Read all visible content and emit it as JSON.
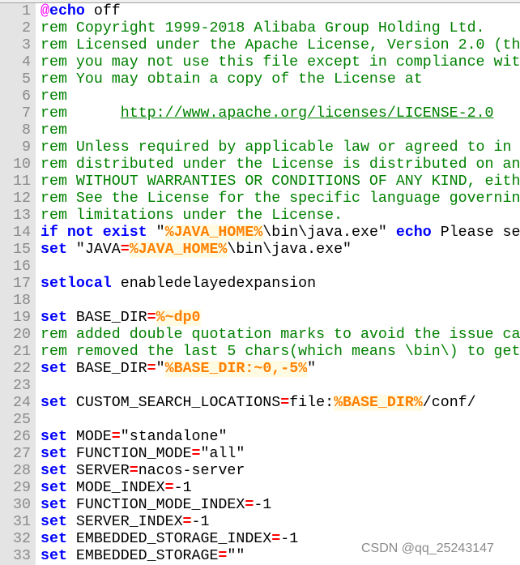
{
  "editor": {
    "colors": {
      "keyword": "#0000ff",
      "comment": "#008000",
      "variable": "#ff8000",
      "operator": "#ff0000",
      "gutter": "#e4e4e4"
    },
    "lines": [
      {
        "n": "1",
        "tokens": [
          {
            "t": "at",
            "text": "@"
          },
          {
            "t": "kw",
            "text": "echo"
          },
          {
            "t": "def",
            "text": " off"
          }
        ]
      },
      {
        "n": "2",
        "tokens": [
          {
            "t": "cm",
            "text": "rem Copyright 1999-2018 Alibaba Group Holding Ltd."
          }
        ]
      },
      {
        "n": "3",
        "tokens": [
          {
            "t": "cm",
            "text": "rem Licensed under the Apache License, Version 2.0 (th"
          }
        ]
      },
      {
        "n": "4",
        "tokens": [
          {
            "t": "cm",
            "text": "rem you may not use this file except in compliance wit"
          }
        ]
      },
      {
        "n": "5",
        "tokens": [
          {
            "t": "cm",
            "text": "rem You may obtain a copy of the License at"
          }
        ]
      },
      {
        "n": "6",
        "tokens": [
          {
            "t": "cm",
            "text": "rem"
          }
        ]
      },
      {
        "n": "7",
        "tokens": [
          {
            "t": "cm",
            "text": "rem      "
          },
          {
            "t": "url",
            "text": "http://www.apache.org/licenses/LICENSE-2.0"
          }
        ]
      },
      {
        "n": "8",
        "tokens": [
          {
            "t": "cm",
            "text": "rem"
          }
        ]
      },
      {
        "n": "9",
        "tokens": [
          {
            "t": "cm",
            "text": "rem Unless required by applicable law or agreed to in"
          }
        ]
      },
      {
        "n": "10",
        "tokens": [
          {
            "t": "cm",
            "text": "rem distributed under the License is distributed on an"
          }
        ]
      },
      {
        "n": "11",
        "tokens": [
          {
            "t": "cm",
            "text": "rem WITHOUT WARRANTIES OR CONDITIONS OF ANY KIND, eith"
          }
        ]
      },
      {
        "n": "12",
        "tokens": [
          {
            "t": "cm",
            "text": "rem See the License for the specific language governin"
          }
        ]
      },
      {
        "n": "13",
        "tokens": [
          {
            "t": "cm",
            "text": "rem limitations under the License."
          }
        ]
      },
      {
        "n": "14",
        "tokens": [
          {
            "t": "kw",
            "text": "if not exist"
          },
          {
            "t": "def",
            "text": " \""
          },
          {
            "t": "var",
            "text": "%JAVA_HOME%"
          },
          {
            "t": "def",
            "text": "\\bin\\java.exe\" "
          },
          {
            "t": "kw",
            "text": "echo"
          },
          {
            "t": "def",
            "text": " Please se"
          }
        ]
      },
      {
        "n": "15",
        "tokens": [
          {
            "t": "kw",
            "text": "set"
          },
          {
            "t": "def",
            "text": " \"JAVA"
          },
          {
            "t": "op",
            "text": "="
          },
          {
            "t": "var",
            "text": "%JAVA_HOME%"
          },
          {
            "t": "def",
            "text": "\\bin\\java.exe\""
          }
        ]
      },
      {
        "n": "16",
        "tokens": []
      },
      {
        "n": "17",
        "tokens": [
          {
            "t": "kw",
            "text": "setlocal"
          },
          {
            "t": "def",
            "text": " enabledelayedexpansion"
          }
        ]
      },
      {
        "n": "18",
        "tokens": []
      },
      {
        "n": "19",
        "tokens": [
          {
            "t": "kw",
            "text": "set"
          },
          {
            "t": "def",
            "text": " BASE_DIR"
          },
          {
            "t": "op",
            "text": "="
          },
          {
            "t": "var",
            "text": "%~dp0"
          }
        ]
      },
      {
        "n": "20",
        "tokens": [
          {
            "t": "cm",
            "text": "rem added double quotation marks to avoid the issue ca"
          }
        ]
      },
      {
        "n": "21",
        "tokens": [
          {
            "t": "cm",
            "text": "rem removed the last 5 chars(which means \\bin\\) to get"
          }
        ]
      },
      {
        "n": "22",
        "tokens": [
          {
            "t": "kw",
            "text": "set"
          },
          {
            "t": "def",
            "text": " BASE_DIR"
          },
          {
            "t": "op",
            "text": "="
          },
          {
            "t": "def",
            "text": "\""
          },
          {
            "t": "var",
            "text": "%BASE_DIR:~0,-5%"
          },
          {
            "t": "def",
            "text": "\""
          }
        ]
      },
      {
        "n": "23",
        "tokens": []
      },
      {
        "n": "24",
        "tokens": [
          {
            "t": "kw",
            "text": "set"
          },
          {
            "t": "def",
            "text": " CUSTOM_SEARCH_LOCATIONS"
          },
          {
            "t": "op",
            "text": "="
          },
          {
            "t": "def",
            "text": "file:"
          },
          {
            "t": "var",
            "text": "%BASE_DIR%"
          },
          {
            "t": "def",
            "text": "/conf/"
          }
        ]
      },
      {
        "n": "25",
        "tokens": []
      },
      {
        "n": "26",
        "tokens": [
          {
            "t": "kw",
            "text": "set"
          },
          {
            "t": "def",
            "text": " MODE"
          },
          {
            "t": "op",
            "text": "="
          },
          {
            "t": "def",
            "text": "\"standalone\""
          }
        ]
      },
      {
        "n": "27",
        "tokens": [
          {
            "t": "kw",
            "text": "set"
          },
          {
            "t": "def",
            "text": " FUNCTION_MODE"
          },
          {
            "t": "op",
            "text": "="
          },
          {
            "t": "def",
            "text": "\"all\""
          }
        ]
      },
      {
        "n": "28",
        "tokens": [
          {
            "t": "kw",
            "text": "set"
          },
          {
            "t": "def",
            "text": " SERVER"
          },
          {
            "t": "op",
            "text": "="
          },
          {
            "t": "def",
            "text": "nacos-server"
          }
        ]
      },
      {
        "n": "29",
        "tokens": [
          {
            "t": "kw",
            "text": "set"
          },
          {
            "t": "def",
            "text": " MODE_INDEX"
          },
          {
            "t": "op",
            "text": "="
          },
          {
            "t": "def",
            "text": "-1"
          }
        ]
      },
      {
        "n": "30",
        "tokens": [
          {
            "t": "kw",
            "text": "set"
          },
          {
            "t": "def",
            "text": " FUNCTION_MODE_INDEX"
          },
          {
            "t": "op",
            "text": "="
          },
          {
            "t": "def",
            "text": "-1"
          }
        ]
      },
      {
        "n": "31",
        "tokens": [
          {
            "t": "kw",
            "text": "set"
          },
          {
            "t": "def",
            "text": " SERVER_INDEX"
          },
          {
            "t": "op",
            "text": "="
          },
          {
            "t": "def",
            "text": "-1"
          }
        ]
      },
      {
        "n": "32",
        "tokens": [
          {
            "t": "kw",
            "text": "set"
          },
          {
            "t": "def",
            "text": " EMBEDDED_STORAGE_INDEX"
          },
          {
            "t": "op",
            "text": "="
          },
          {
            "t": "def",
            "text": "-1"
          }
        ]
      },
      {
        "n": "33",
        "tokens": [
          {
            "t": "kw",
            "text": "set"
          },
          {
            "t": "def",
            "text": " EMBEDDED_STORAGE"
          },
          {
            "t": "op",
            "text": "="
          },
          {
            "t": "def",
            "text": "\"\""
          }
        ]
      }
    ]
  },
  "watermark": "CSDN @qq_25243147"
}
